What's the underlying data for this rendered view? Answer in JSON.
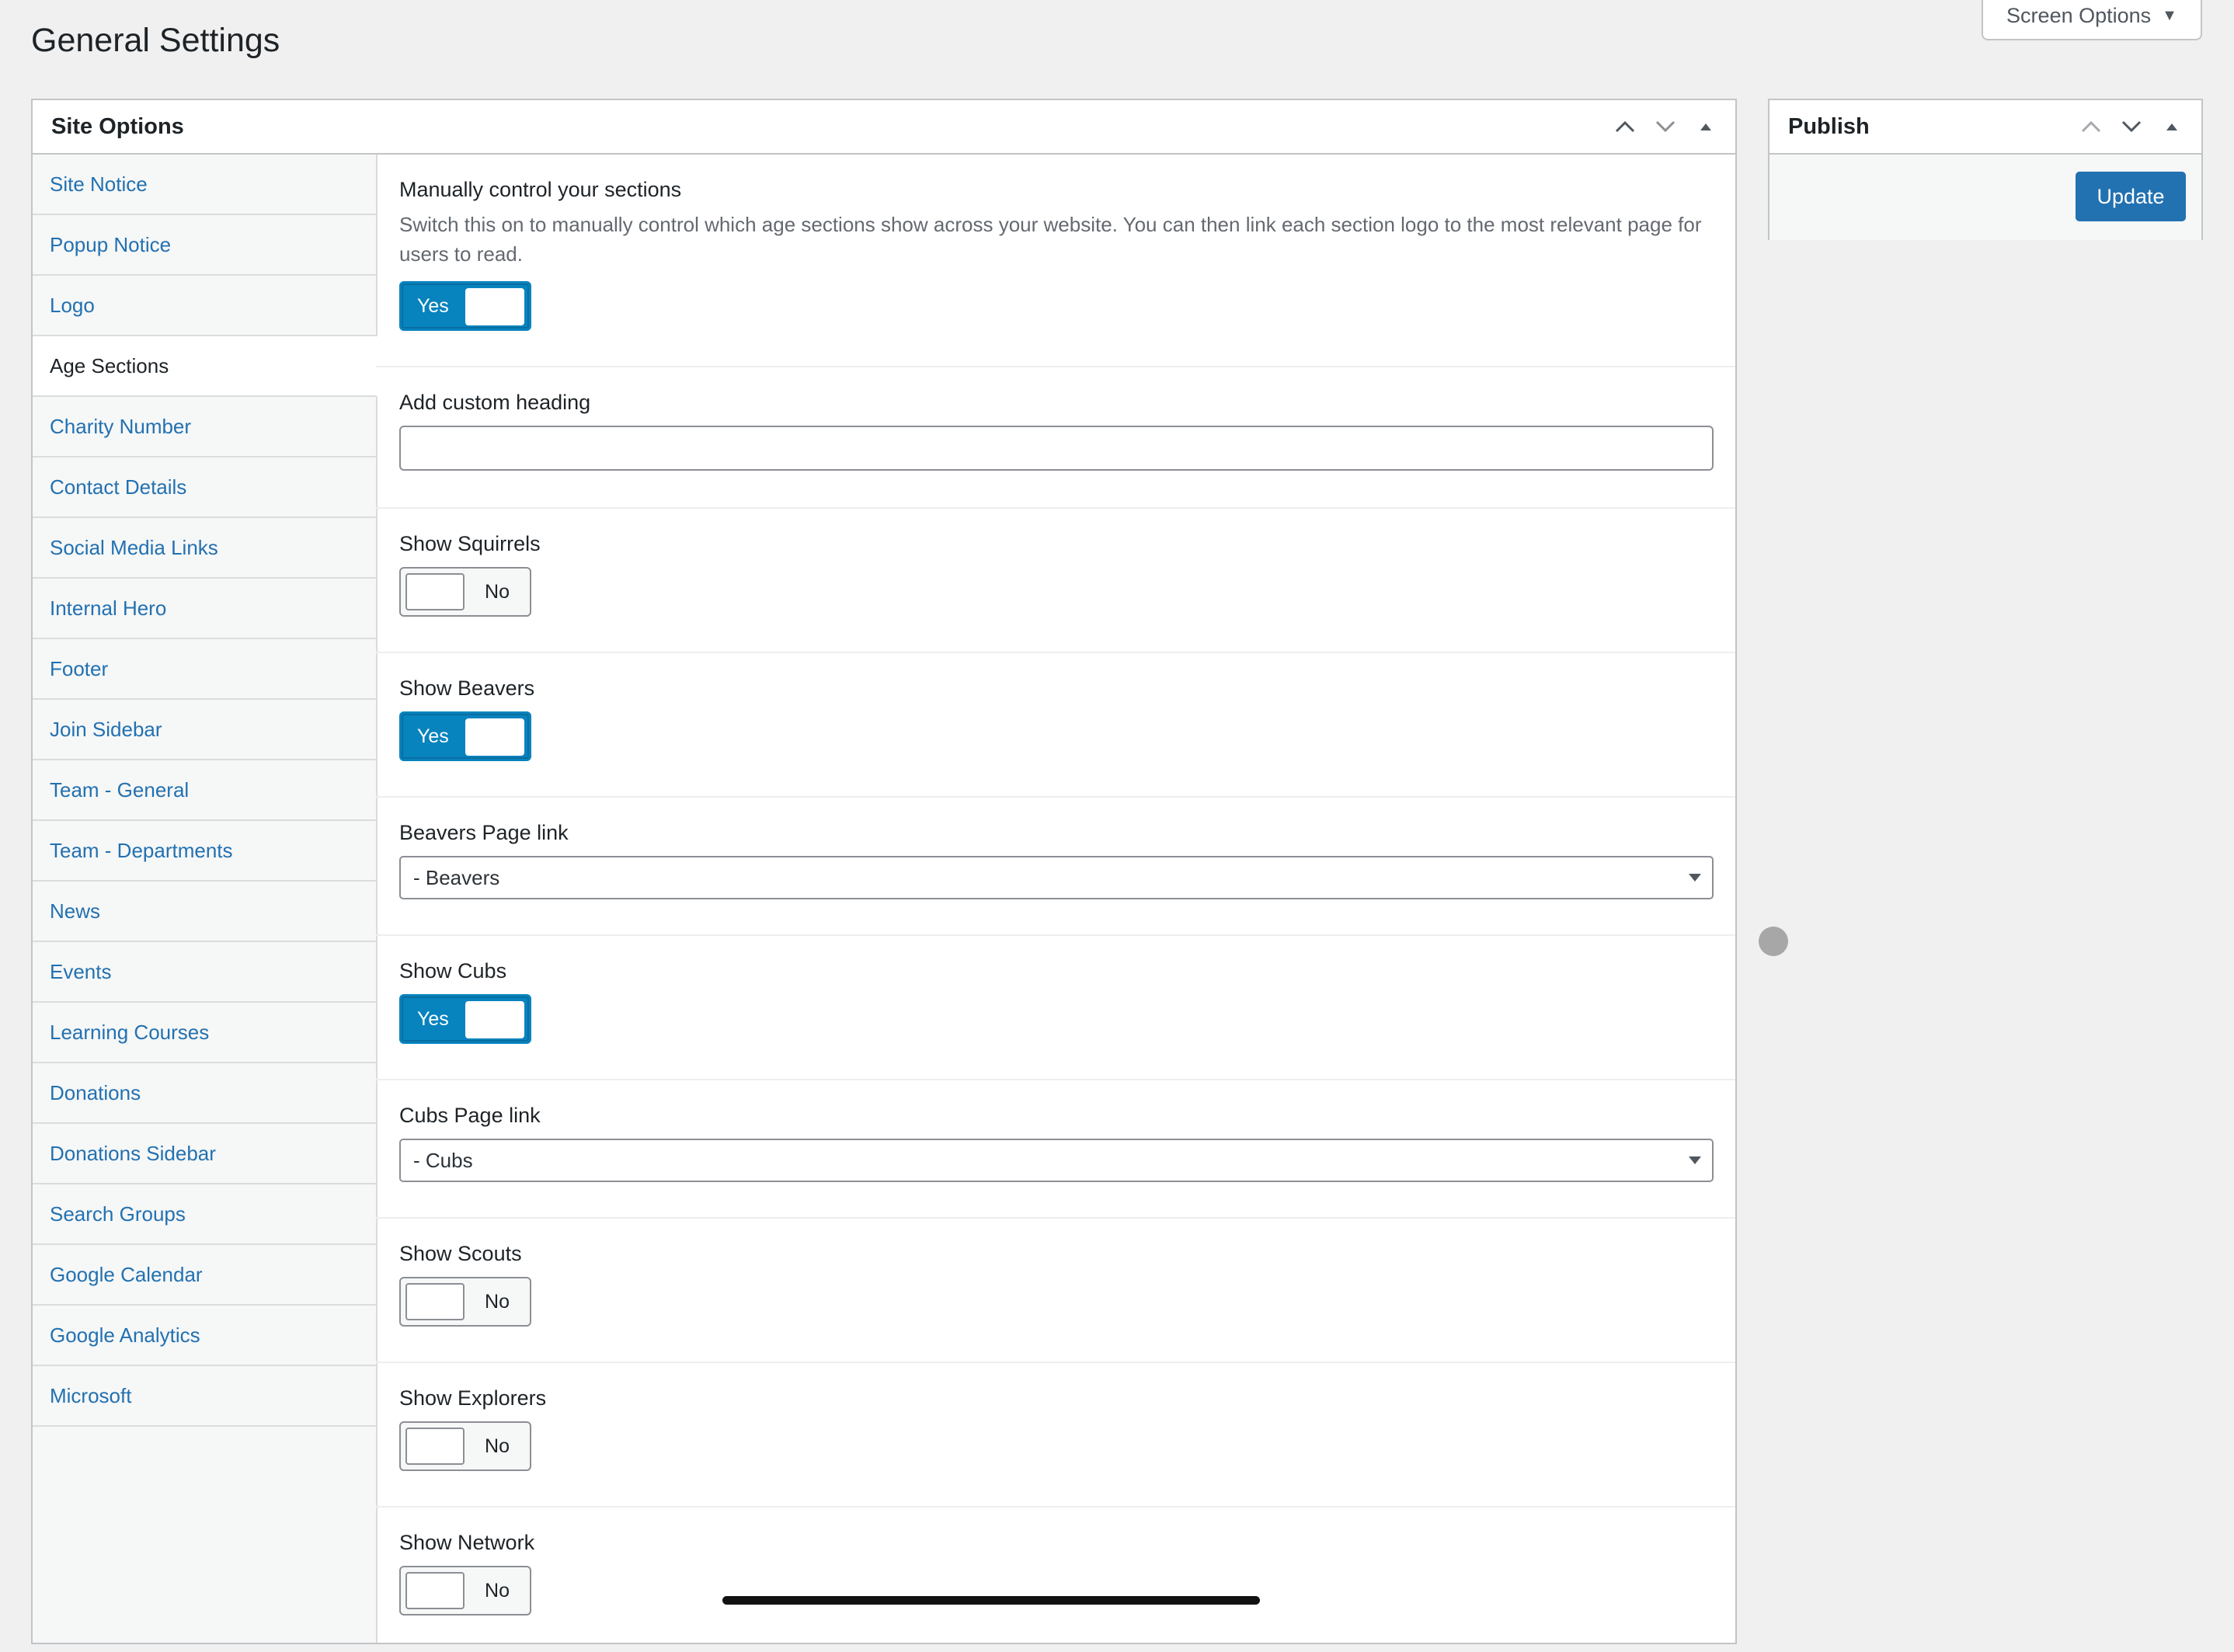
{
  "page": {
    "title": "General Settings"
  },
  "screen_options": {
    "label": "Screen Options"
  },
  "site_options": {
    "title": "Site Options",
    "tabs": [
      {
        "label": "Site Notice"
      },
      {
        "label": "Popup Notice"
      },
      {
        "label": "Logo"
      },
      {
        "label": "Age Sections",
        "active": true
      },
      {
        "label": "Charity Number"
      },
      {
        "label": "Contact Details"
      },
      {
        "label": "Social Media Links"
      },
      {
        "label": "Internal Hero"
      },
      {
        "label": "Footer"
      },
      {
        "label": "Join Sidebar"
      },
      {
        "label": "Team - General"
      },
      {
        "label": "Team - Departments"
      },
      {
        "label": "News"
      },
      {
        "label": "Events"
      },
      {
        "label": "Learning Courses"
      },
      {
        "label": "Donations"
      },
      {
        "label": "Donations Sidebar"
      },
      {
        "label": "Search Groups"
      },
      {
        "label": "Google Calendar"
      },
      {
        "label": "Google Analytics"
      },
      {
        "label": "Microsoft"
      }
    ],
    "fields": {
      "manual": {
        "label": "Manually control your sections",
        "description": "Switch this on to manually control which age sections show across your website. You can then link each section logo to the most relevant page for users to read.",
        "toggle": "Yes"
      },
      "custom_heading": {
        "label": "Add custom heading",
        "value": ""
      },
      "squirrels": {
        "label": "Show Squirrels",
        "toggle": "No"
      },
      "beavers": {
        "label": "Show Beavers",
        "toggle": "Yes"
      },
      "beavers_link": {
        "label": "Beavers Page link",
        "value": "- Beavers"
      },
      "cubs": {
        "label": "Show Cubs",
        "toggle": "Yes"
      },
      "cubs_link": {
        "label": "Cubs Page link",
        "value": "- Cubs"
      },
      "scouts": {
        "label": "Show Scouts",
        "toggle": "No"
      },
      "explorers": {
        "label": "Show Explorers",
        "toggle": "No"
      },
      "network": {
        "label": "Show Network",
        "toggle": "No"
      }
    }
  },
  "publish": {
    "title": "Publish",
    "update_label": "Update"
  },
  "colors": {
    "accent": "#2271b1",
    "toggle_on": "#0783be"
  },
  "icons": [
    "chevron-up-icon",
    "chevron-down-icon",
    "collapse-triangle-icon",
    "dropdown-arrow-icon"
  ]
}
